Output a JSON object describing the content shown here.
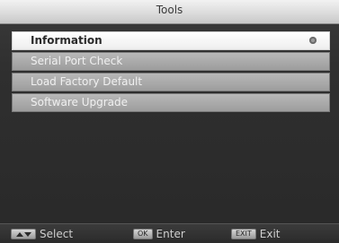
{
  "header": {
    "title": "Tools"
  },
  "menu": {
    "items": [
      {
        "label": "Information",
        "selected": true,
        "icon": "ok-dot-icon"
      },
      {
        "label": "Serial Port Check",
        "selected": false
      },
      {
        "label": "Load Factory Default",
        "selected": false
      },
      {
        "label": "Software Upgrade",
        "selected": false
      }
    ]
  },
  "footer": {
    "hints": [
      {
        "key_icon": "up-down-arrows-icon",
        "label": "Select"
      },
      {
        "key": "OK",
        "label": "Enter"
      },
      {
        "key": "EXIT",
        "label": "Exit"
      }
    ]
  },
  "colors": {
    "title_bar": "#e6e6e6",
    "selected_item": "#f6f6f6",
    "menu_item": "#a9a9a9",
    "background": "#2e2e2e"
  }
}
